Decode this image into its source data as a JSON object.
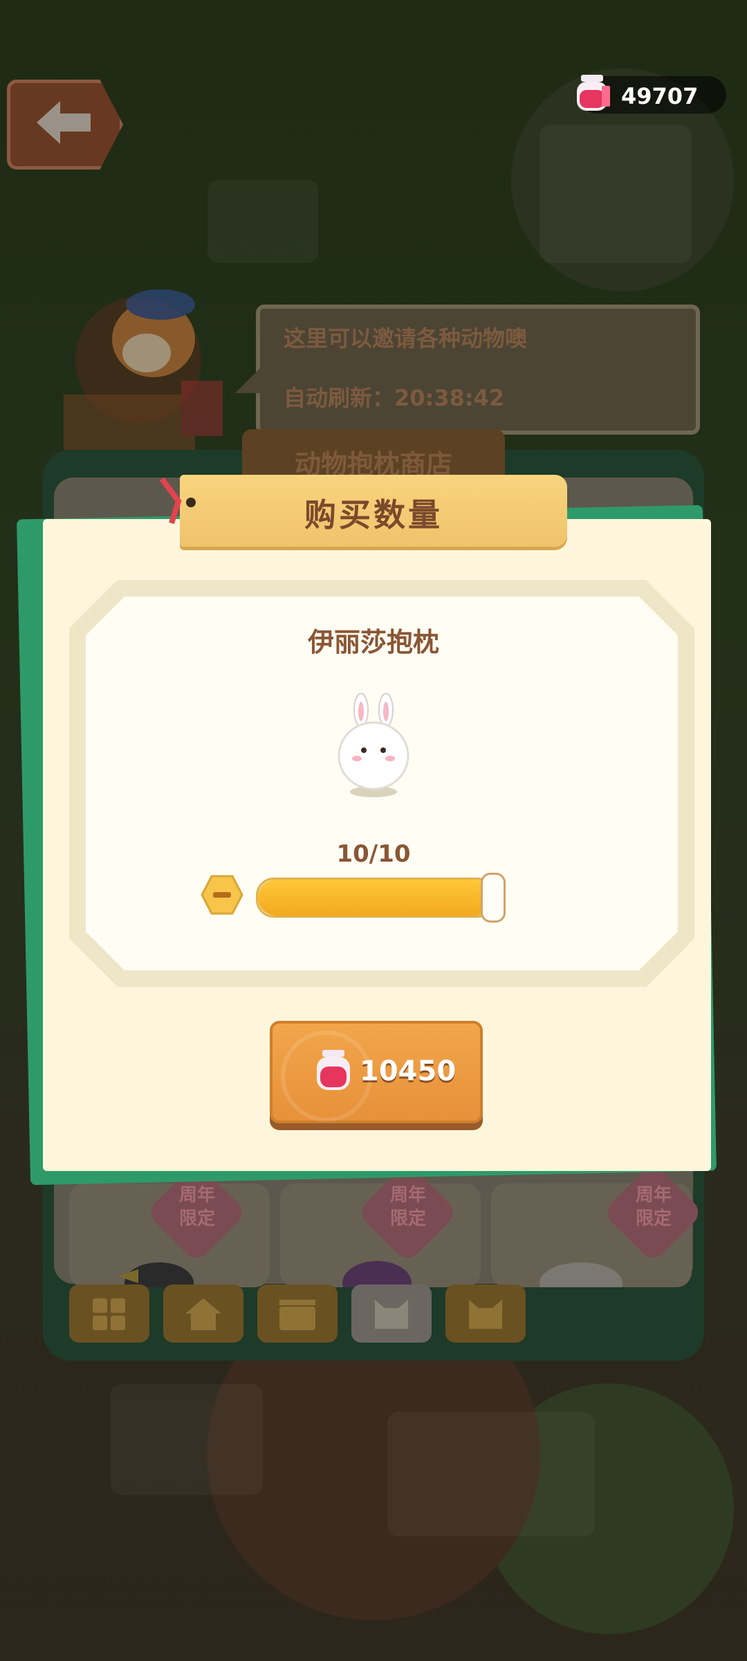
{
  "hud": {
    "currency_value": "49707",
    "currency_icon": "pink-jar-icon"
  },
  "bubble": {
    "line1": "这里可以邀请各种动物噢",
    "line2": "自动刷新：20:38:42"
  },
  "shop": {
    "title": "动物抱枕商店",
    "cards": [
      {
        "badge": "周年\n限定"
      },
      {
        "badge": "周年\n限定"
      },
      {
        "badge": "周年\n限定"
      }
    ],
    "tabs": [
      {
        "icon": "grid-icon"
      },
      {
        "icon": "house-icon"
      },
      {
        "icon": "clapperboard-icon"
      },
      {
        "icon": "cat-face-icon",
        "active": true
      },
      {
        "icon": "cat-face-icon"
      }
    ]
  },
  "modal": {
    "title": "购买数量",
    "item_name": "伊丽莎抱枕",
    "item_icon": "bunny-pillow-icon",
    "quantity_label": "10/10",
    "quantity_fraction": 1.0,
    "buy_price": "10450",
    "buy_icon": "pink-jar-icon"
  },
  "colors": {
    "modal_bg": "#fdf6dc",
    "modal_green": "#2e9a6a",
    "header": "#f9d47e",
    "slider_fill": "#f3a91f",
    "buy_button": "#e7913a",
    "jar_pink": "#e6355e"
  }
}
